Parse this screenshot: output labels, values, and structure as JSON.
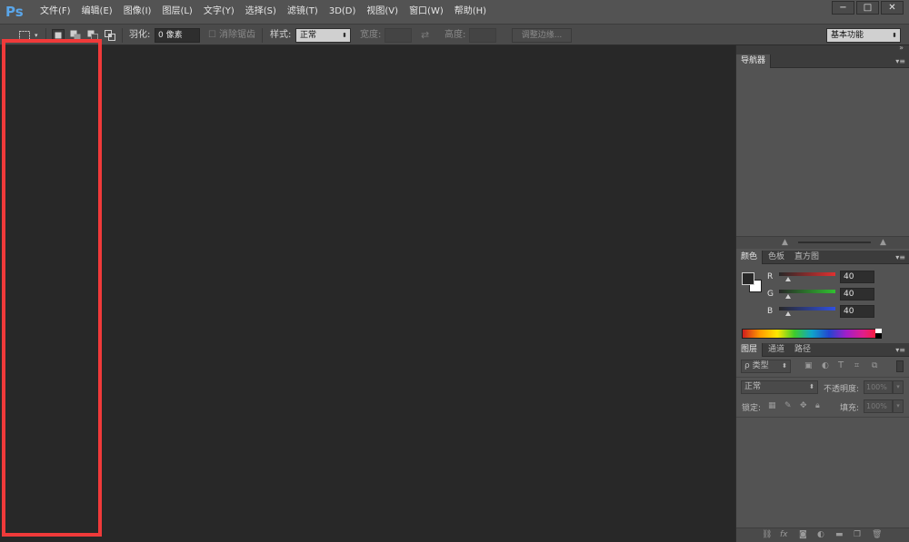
{
  "app": {
    "logo": "Ps"
  },
  "menu": {
    "items": [
      "文件(F)",
      "编辑(E)",
      "图像(I)",
      "图层(L)",
      "文字(Y)",
      "选择(S)",
      "滤镜(T)",
      "3D(D)",
      "视图(V)",
      "窗口(W)",
      "帮助(H)"
    ]
  },
  "window_controls": {
    "minimize": "−",
    "maximize": "□",
    "close": "✕"
  },
  "options_bar": {
    "feather_label": "羽化:",
    "feather_value": "0 像素",
    "antialias_label": "消除锯齿",
    "style_label": "样式:",
    "style_value": "正常",
    "width_label": "宽度:",
    "height_label": "高度:",
    "refine_edge_label": "调整边缘...",
    "workspace_value": "基本功能"
  },
  "navigator_panel": {
    "tab": "导航器"
  },
  "color_panel": {
    "tabs": [
      "颜色",
      "色板",
      "直方图"
    ],
    "channels": [
      {
        "label": "R",
        "value": "40",
        "color": "#e03030"
      },
      {
        "label": "G",
        "value": "40",
        "color": "#30c030"
      },
      {
        "label": "B",
        "value": "40",
        "color": "#3050e0"
      }
    ],
    "fraction": 0.157
  },
  "layers_panel": {
    "tabs": [
      "图层",
      "通道",
      "路径"
    ],
    "filter_label": "ρ 类型",
    "blend_value": "正常",
    "opacity_label": "不透明度:",
    "opacity_value": "100%",
    "lock_label": "锁定:",
    "fill_label": "填充:",
    "fill_value": "100%"
  },
  "colors": {
    "highlight": "#f03a3a",
    "canvas_bg": "#282828",
    "logo": "#5aa6ea"
  }
}
